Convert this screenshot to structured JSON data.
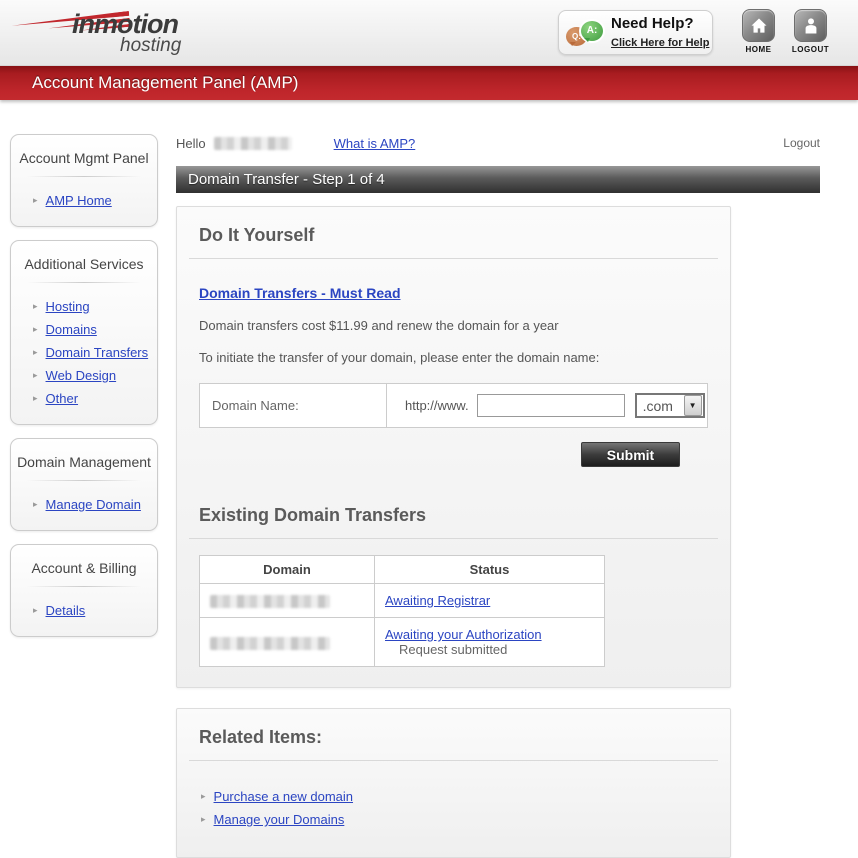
{
  "icons": {
    "bullet": "▸",
    "dropdown_arrow": "▼"
  },
  "colors": {
    "brand_red": "#c1272d",
    "banner_red": "#bf262b",
    "link_blue": "#2b45c2",
    "bar_gray": "#303030"
  },
  "header": {
    "logo_line1": "inmotion",
    "logo_line2": "hosting",
    "help_title": "Need Help?",
    "help_link": "Click Here for Help",
    "bubble_q": "Q:",
    "bubble_a": "A:",
    "home_label": "HOME",
    "logout_label": "LOGOUT"
  },
  "banner": {
    "title": "Account Management Panel (AMP)"
  },
  "sidebar": {
    "sections": [
      {
        "title": "Account Mgmt Panel",
        "links": [
          "AMP Home"
        ]
      },
      {
        "title": "Additional Services",
        "links": [
          "Hosting",
          "Domains",
          "Domain Transfers",
          "Web Design",
          "Other"
        ]
      },
      {
        "title": "Domain Management",
        "links": [
          "Manage Domain"
        ]
      },
      {
        "title": "Account & Billing",
        "links": [
          "Details"
        ]
      }
    ]
  },
  "main": {
    "greeting": "Hello",
    "what_is_amp": "What is AMP?",
    "logout": "Logout",
    "page_title": "Domain Transfer - Step 1 of 4",
    "diy": {
      "heading": "Do It Yourself",
      "must_read": "Domain Transfers - Must Read",
      "cost_text": "Domain transfers cost $11.99 and renew the domain for a year",
      "initiate_text": "To initiate the transfer of your domain, please enter the domain name:",
      "domain_label": "Domain Name:",
      "url_prefix": "http://www.",
      "domain_input_value": "",
      "tld_selected": ".com",
      "submit_label": "Submit"
    },
    "existing": {
      "heading": "Existing Domain Transfers",
      "columns": [
        "Domain",
        "Status"
      ],
      "rows": [
        {
          "status_link": "Awaiting Registrar",
          "status_note": ""
        },
        {
          "status_link": "Awaiting your Authorization",
          "status_note": "Request submitted"
        }
      ]
    },
    "related": {
      "heading": "Related Items:",
      "links": [
        "Purchase a new domain",
        "Manage your Domains"
      ]
    }
  }
}
